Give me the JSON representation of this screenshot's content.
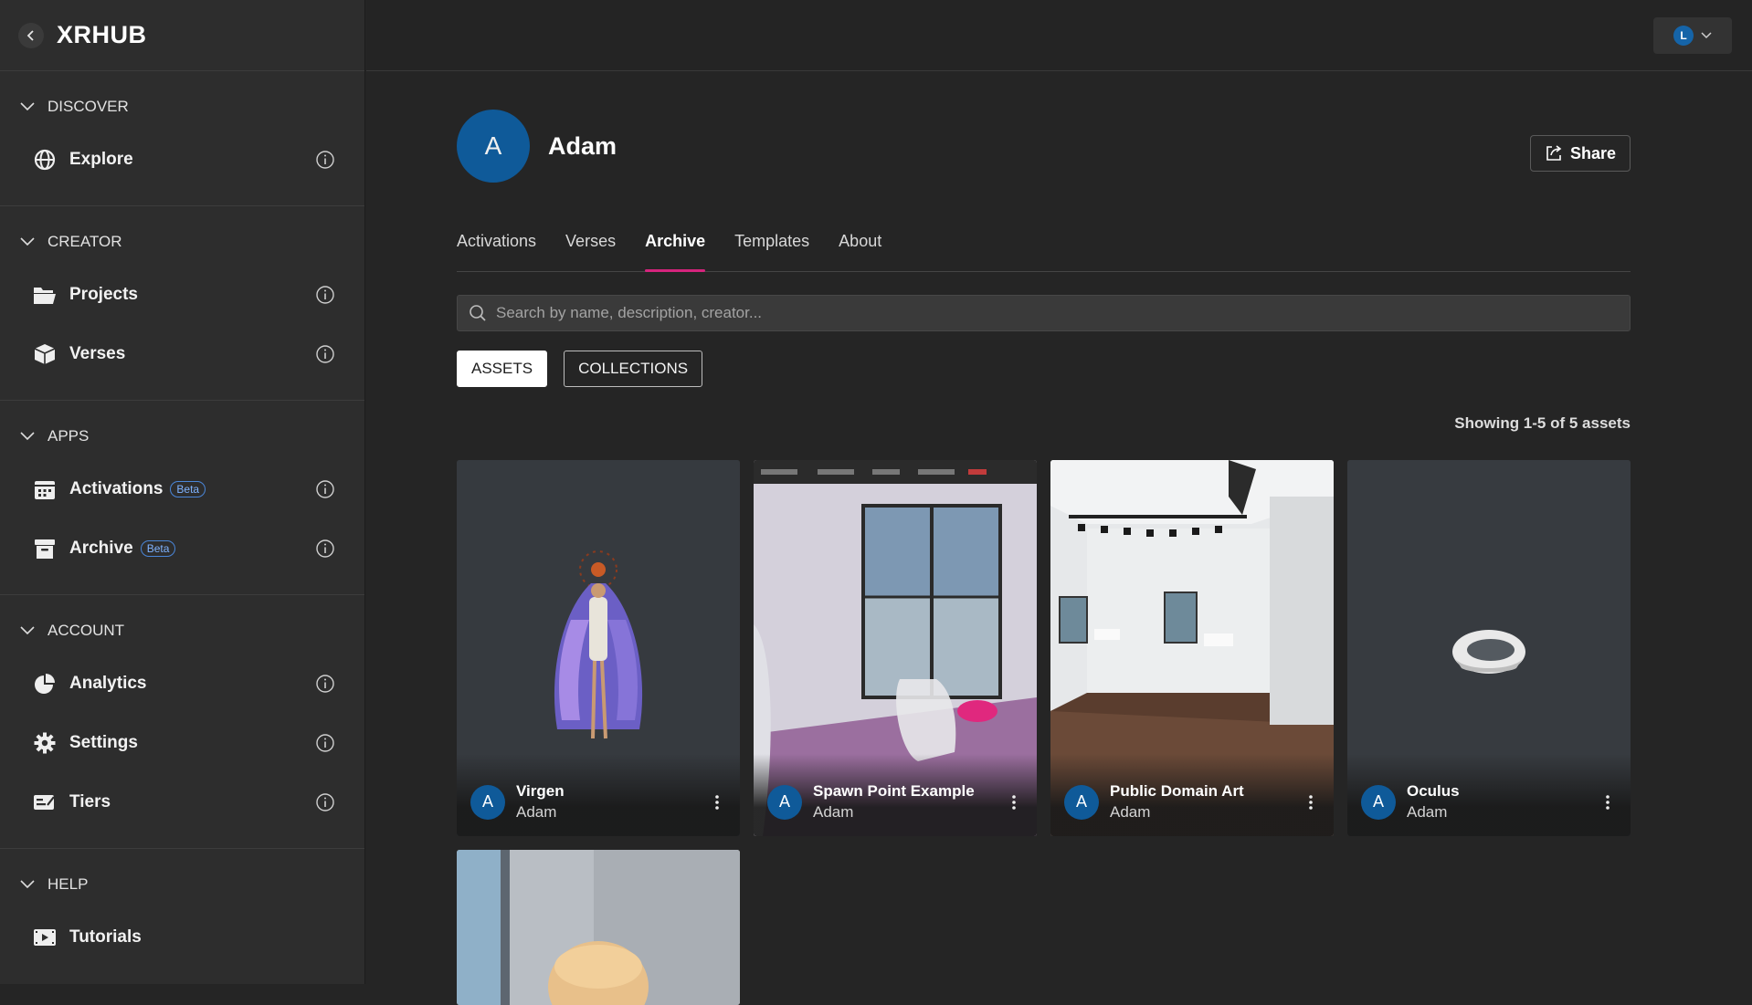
{
  "app": {
    "title": "XRHUB"
  },
  "sidebar": {
    "sections": [
      {
        "title": "DISCOVER",
        "items": [
          {
            "label": "Explore"
          }
        ]
      },
      {
        "title": "CREATOR",
        "items": [
          {
            "label": "Projects"
          },
          {
            "label": "Verses"
          }
        ]
      },
      {
        "title": "APPS",
        "items": [
          {
            "label": "Activations",
            "badge": "Beta"
          },
          {
            "label": "Archive",
            "badge": "Beta"
          }
        ]
      },
      {
        "title": "ACCOUNT",
        "items": [
          {
            "label": "Analytics"
          },
          {
            "label": "Settings"
          },
          {
            "label": "Tiers"
          }
        ]
      },
      {
        "title": "HELP",
        "items": [
          {
            "label": "Tutorials"
          }
        ]
      }
    ]
  },
  "topbar": {
    "user_initial": "L"
  },
  "profile": {
    "initial": "A",
    "name": "Adam",
    "share_label": "Share"
  },
  "tabs": [
    {
      "label": "Activations"
    },
    {
      "label": "Verses"
    },
    {
      "label": "Archive"
    },
    {
      "label": "Templates"
    },
    {
      "label": "About"
    }
  ],
  "search": {
    "placeholder": "Search by name, description, creator..."
  },
  "filters": {
    "assets": "ASSETS",
    "collections": "COLLECTIONS"
  },
  "results": {
    "count_text": "Showing 1-5 of 5 assets"
  },
  "assets": [
    {
      "title": "Virgen",
      "creator": "Adam",
      "initial": "A"
    },
    {
      "title": "Spawn Point Example",
      "creator": "Adam",
      "initial": "A"
    },
    {
      "title": "Public Domain Art",
      "creator": "Adam",
      "initial": "A"
    },
    {
      "title": "Oculus",
      "creator": "Adam",
      "initial": "A"
    }
  ],
  "colors": {
    "accent": "#d6247d",
    "avatar": "#0f5a99",
    "beta": "#4a86d8"
  }
}
